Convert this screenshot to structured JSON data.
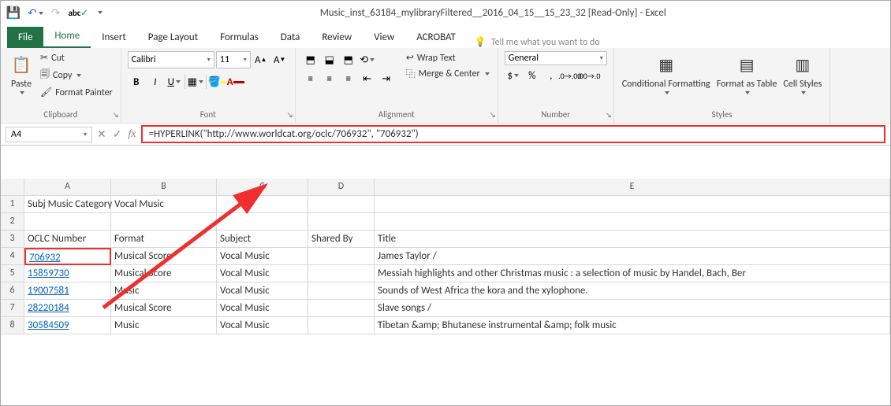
{
  "titlebar": {
    "title": "Music_inst_63184_mylibraryFiltered__2016_04_15__15_23_32  [Read-Only]  -  Excel"
  },
  "tabs": {
    "file": "File",
    "home": "Home",
    "insert": "Insert",
    "page_layout": "Page Layout",
    "formulas": "Formulas",
    "data": "Data",
    "review": "Review",
    "view": "View",
    "acrobat": "ACROBAT",
    "tellme": "Tell me what you want to do"
  },
  "ribbon": {
    "clipboard": {
      "label": "Clipboard",
      "paste": "Paste",
      "cut": "Cut",
      "copy": "Copy",
      "fp": "Format Painter"
    },
    "font": {
      "label": "Font",
      "name": "Calibri",
      "size": "11"
    },
    "alignment": {
      "label": "Alignment",
      "wrap": "Wrap Text",
      "merge": "Merge & Center"
    },
    "number": {
      "label": "Number",
      "format": "General"
    },
    "styles": {
      "label": "Styles",
      "cf": "Conditional Formatting",
      "ft": "Format as Table",
      "cs": "Cell Styles"
    }
  },
  "formula_bar": {
    "namebox": "A4",
    "formula": "=HYPERLINK(\"http://www.worldcat.org/oclc/706932\", \"706932\")"
  },
  "sheet": {
    "cols": [
      "A",
      "B",
      "C",
      "D",
      "E"
    ],
    "rows": [
      "1",
      "2",
      "3",
      "4",
      "5",
      "6",
      "7",
      "8"
    ],
    "r1": {
      "a": "Subj Music Category Vocal Music"
    },
    "r3": {
      "a": "OCLC Number",
      "b": "Format",
      "c": "Subject",
      "d": "Shared By",
      "e": "Title"
    },
    "r4": {
      "a": "706932",
      "b": "Musical Score",
      "c": "Vocal Music",
      "d": "",
      "e": "James Taylor /"
    },
    "r5": {
      "a": "15859730",
      "b": "Musical Score",
      "c": "Vocal Music",
      "d": "",
      "e": "Messiah highlights and other Christmas music : a selection of music by Handel, Bach, Ber"
    },
    "r6": {
      "a": "19007581",
      "b": "Music",
      "c": "Vocal Music",
      "d": "",
      "e": "Sounds of West Africa the kora and the xylophone."
    },
    "r7": {
      "a": "28220184",
      "b": "Musical Score",
      "c": "Vocal Music",
      "d": "",
      "e": "Slave songs /"
    },
    "r8": {
      "a": "30584509",
      "b": "Music",
      "c": "Vocal Music",
      "d": "",
      "e": "Tibetan &amp; Bhutanese instrumental &amp; folk music"
    }
  }
}
